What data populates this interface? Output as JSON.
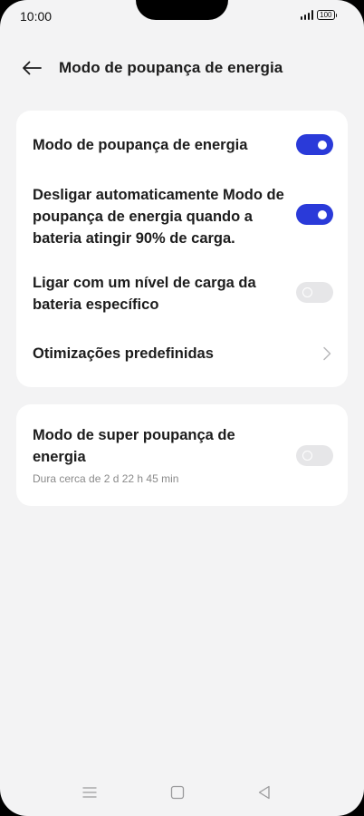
{
  "status_bar": {
    "time": "10:00",
    "battery": "100"
  },
  "header": {
    "title": "Modo de poupança de energia"
  },
  "settings": {
    "power_saving": {
      "label": "Modo de poupança de energia",
      "enabled": true
    },
    "auto_disable": {
      "label": "Desligar automaticamente Modo de poupança de energia quando a bateria atingir 90% de carga.",
      "enabled": true
    },
    "specific_level": {
      "label": "Ligar com um nível de carga da bateria específico",
      "enabled": false
    },
    "optimizations": {
      "label": "Otimizações predefinidas"
    },
    "super_saving": {
      "label": "Modo de super poupança de energia",
      "subtitle": "Dura cerca de 2 d 22 h 45 min",
      "enabled": false
    }
  },
  "colors": {
    "accent": "#2a3ad9",
    "background": "#f3f3f4",
    "card": "#ffffff",
    "toggle_off": "#e6e6e8"
  },
  "icons": [
    "back-arrow-icon",
    "chevron-right-icon",
    "menu-icon",
    "home-icon",
    "back-triangle-icon",
    "signal-icon",
    "battery-icon"
  ]
}
